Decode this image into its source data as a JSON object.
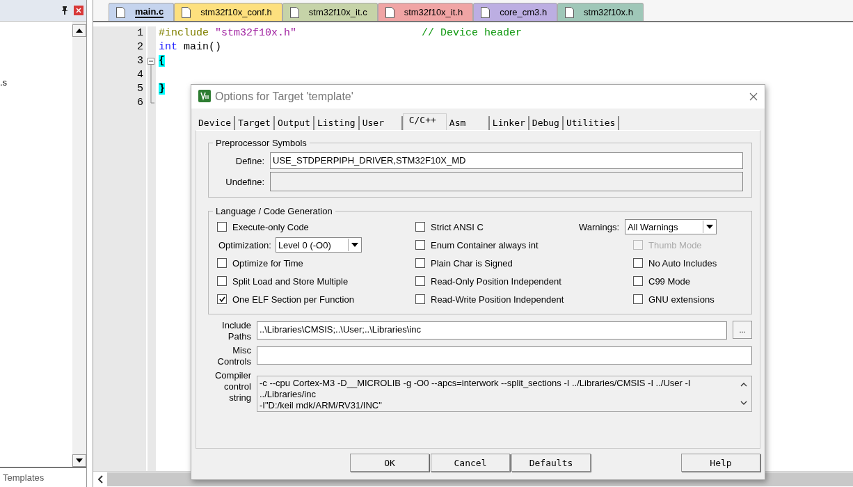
{
  "side_panel": {
    "file_fragment": ".s",
    "bottom_tab": "Templates"
  },
  "editor_tabs": [
    {
      "label": "main.c",
      "selected": true,
      "color": "#c5d4ee"
    },
    {
      "label": "stm32f10x_conf.h",
      "selected": false,
      "color": "#fde07e"
    },
    {
      "label": "stm32f10x_it.c",
      "selected": false,
      "color": "#c6d3a8"
    },
    {
      "label": "stm32f10x_it.h",
      "selected": false,
      "color": "#f0a4a4"
    },
    {
      "label": "core_cm3.h",
      "selected": false,
      "color": "#bcaee2"
    },
    {
      "label": "stm32f10x.h",
      "selected": false,
      "color": "#9fc7b8"
    }
  ],
  "code_lines": [
    {
      "number": "1",
      "tokens": [
        {
          "kind": "directive",
          "text": "#include"
        },
        {
          "kind": "string",
          "text": "\"stm32f10x.h\""
        },
        {
          "kind": "comment",
          "text": "// Device header"
        }
      ]
    },
    {
      "number": "2",
      "tokens": [
        {
          "kind": "keyword",
          "text": "int"
        },
        {
          "kind": "plain",
          "text": "main()"
        }
      ]
    },
    {
      "number": "3",
      "tokens": [
        {
          "kind": "brace",
          "text": "{"
        }
      ]
    },
    {
      "number": "4"
    },
    {
      "number": "5",
      "tokens": [
        {
          "kind": "brace",
          "text": "}"
        }
      ]
    },
    {
      "number": "6"
    }
  ],
  "dialog": {
    "title": "Options for Target 'template'",
    "tabs": [
      {
        "label": "Device",
        "selected": false
      },
      {
        "label": "Target",
        "selected": false
      },
      {
        "label": "Output",
        "selected": false
      },
      {
        "label": "Listing",
        "selected": false
      },
      {
        "label": "User",
        "selected": false
      },
      {
        "label": "C/C++",
        "selected": true
      },
      {
        "label": "Asm",
        "selected": false
      },
      {
        "label": "Linker",
        "selected": false
      },
      {
        "label": "Debug",
        "selected": false
      },
      {
        "label": "Utilities",
        "selected": false
      }
    ],
    "preprocessor": {
      "title": "Preprocessor Symbols",
      "define_label": "Define:",
      "define_value": "USE_STDPERPIPH_DRIVER,STM32F10X_MD",
      "undefine_label": "Undefine:"
    },
    "language": {
      "title": "Language / Code Generation",
      "columns": [
        [
          {
            "kind": "checkbox",
            "label": "Execute-only Code",
            "checked": false,
            "disabled": false
          },
          {
            "kind": "select",
            "label": "Optimization:",
            "value": "Level 0 (-O0)"
          },
          {
            "kind": "checkbox",
            "label": "Optimize for Time",
            "checked": false,
            "disabled": false
          },
          {
            "kind": "checkbox",
            "label": "Split Load and Store Multiple",
            "checked": false,
            "disabled": false
          },
          {
            "kind": "checkbox",
            "label": "One ELF Section per Function",
            "checked": true,
            "disabled": false
          }
        ],
        [
          {
            "kind": "checkbox",
            "label": "Strict ANSI C",
            "checked": false,
            "disabled": false
          },
          {
            "kind": "checkbox",
            "label": "Enum Container always int",
            "checked": false,
            "disabled": false
          },
          {
            "kind": "checkbox",
            "label": "Plain Char is Signed",
            "checked": false,
            "disabled": false
          },
          {
            "kind": "checkbox",
            "label": "Read-Only Position Independent",
            "checked": false,
            "disabled": false
          },
          {
            "kind": "checkbox",
            "label": "Read-Write Position Independent",
            "checked": false,
            "disabled": false
          }
        ],
        [
          {
            "kind": "select",
            "label": "Warnings:",
            "value": "All Warnings"
          },
          {
            "kind": "checkbox",
            "label": "Thumb Mode",
            "checked": false,
            "disabled": true
          },
          {
            "kind": "checkbox",
            "label": "No Auto Includes",
            "checked": false,
            "disabled": false
          },
          {
            "kind": "checkbox",
            "label": "C99 Mode",
            "checked": false,
            "disabled": false
          },
          {
            "kind": "checkbox",
            "label": "GNU extensions",
            "checked": false,
            "disabled": false
          }
        ]
      ]
    },
    "include": {
      "label_lines": [
        "Include",
        "Paths"
      ],
      "value": "..\\Libraries\\CMSIS;..\\User;..\\Libraries\\inc",
      "browse": "..."
    },
    "misc": {
      "label_lines": [
        "Misc",
        "Controls"
      ]
    },
    "compiler": {
      "label_lines": [
        "Compiler",
        "control",
        "string"
      ],
      "lines": [
        "-c --cpu Cortex-M3 -D__MICROLIB -g -O0 --apcs=interwork --split_sections -I ../Libraries/CMSIS -I ../User -I",
        "../Libraries/inc",
        "-I\"D:/keil mdk/ARM/RV31/INC\""
      ]
    },
    "buttons": [
      "OK",
      "Cancel",
      "Defaults",
      "Help"
    ]
  }
}
